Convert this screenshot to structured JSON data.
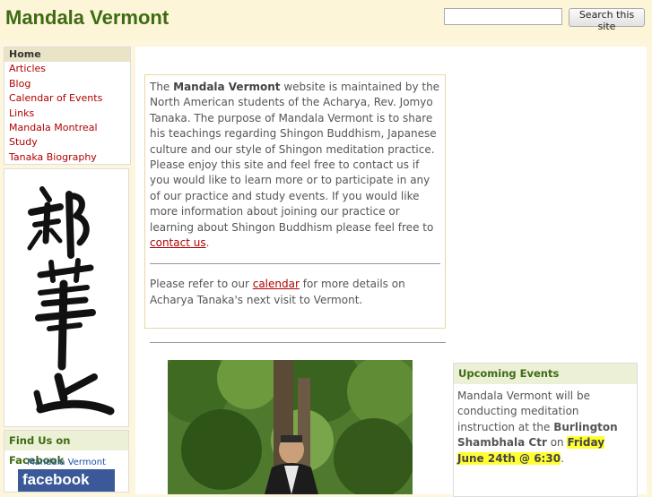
{
  "header": {
    "site_title": "Mandala Vermont",
    "search_button": "Search this site",
    "search_value": ""
  },
  "nav": {
    "items": [
      "Home",
      "Articles",
      "Blog",
      "Calendar of Events",
      "Links",
      "Mandala Montreal",
      "Study",
      "Tanaka Biography"
    ]
  },
  "facebook": {
    "heading": "Find Us on Facebook",
    "link_text": "Mandala Vermont",
    "badge": "facebook"
  },
  "main": {
    "intro": {
      "p1": "The ",
      "site_name": "Mandala Vermont",
      "p2": " website is maintained by the North American students of the Acharya, Rev. Jomyo Tanaka. The purpose of Mandala Vermont is to share his teachings regarding Shingon Buddhism, Japanese culture and our style of Shingon meditation practice. Please enjoy this site and feel free to contact us if you would like to learn more or to participate in any of our practice and study events.  If you would like more information about joining our practice or learning about Shingon Buddhism please feel free to ",
      "contact_link": "contact us",
      "p3": "."
    },
    "calendar": {
      "p1": "Please refer to our ",
      "link": "calendar",
      "p2": " for more details on Acharya Tanaka's next visit to Vermont."
    }
  },
  "events": {
    "heading": "Upcoming Events",
    "t1": "Mandala Vermont will be conducting meditation instruction at the ",
    "bold": "Burlington Shambhala Ctr",
    "t2": " on ",
    "highlight": "Friday June 24th @ 6:30",
    "t3": "."
  }
}
